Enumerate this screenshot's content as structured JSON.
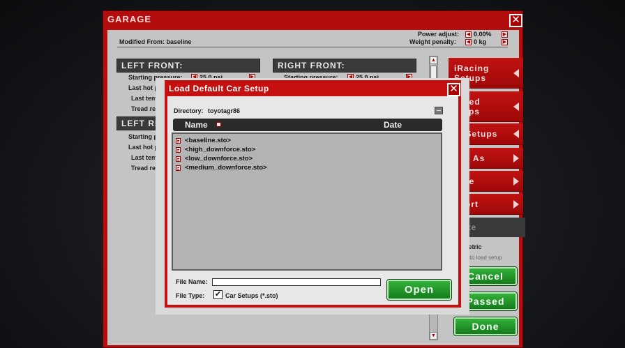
{
  "garage": {
    "title": "GARAGE",
    "modified_from": "Modified From: baseline",
    "power_adjust_label": "Power adjust:",
    "power_adjust_value": "0.00%",
    "weight_penalty_label": "Weight penalty:",
    "weight_penalty_value": "0 kg",
    "left_front": {
      "header": "LEFT FRONT:",
      "starting_pressure_label": "Starting pressure:",
      "starting_pressure_value": "25.0 psi",
      "last_hot_label": "Last hot pr",
      "last_temps_label": "Last temps",
      "tread_label": "Tread rem."
    },
    "right_front": {
      "header": "RIGHT FRONT:",
      "starting_pressure_label": "Starting pressure:",
      "starting_pressure_value": "25.0 psi"
    },
    "left_rear": {
      "header": "LEFT RE",
      "starting_label": "Starting pre",
      "last_hot_label": "Last hot pr",
      "last_temps_label": "Last temps",
      "tread_label": "Tread rem."
    },
    "side_menu": [
      {
        "label1": "iRacing",
        "label2": "Setups",
        "dir": "left"
      },
      {
        "label1": "hared",
        "label2": "etups",
        "dir": "left"
      },
      {
        "label1": "ly Setups",
        "label2": "",
        "dir": "left"
      },
      {
        "label1": "ave As",
        "label2": "",
        "dir": "right"
      },
      {
        "label1": "hare",
        "label2": "",
        "dir": "right"
      },
      {
        "label1": "xport",
        "label2": "",
        "dir": "right"
      }
    ],
    "delete_label": "elete",
    "metric_label": "Metric",
    "auto_load_label": "Auto load setup",
    "cancel_label": "Cancel",
    "passed_label": "Passed",
    "done_label": "Done"
  },
  "dialog": {
    "title": "Load Default Car Setup",
    "directory_label": "Directory:",
    "directory_value": "toyotagr86",
    "columns": {
      "name": "Name",
      "date": "Date"
    },
    "files": [
      "<baseline.sto>",
      "<high_downforce.sto>",
      "<low_downforce.sto>",
      "<medium_downforce.sto>"
    ],
    "file_name_label": "File Name:",
    "file_name_value": "",
    "file_type_label": "File Type:",
    "file_type_check": "✔",
    "file_type_value": "Car Setups (*.sto)",
    "open_label": "Open"
  },
  "icons": {
    "close": "close-icon",
    "arrow_left": "arrow-left-icon",
    "arrow_right": "arrow-right-icon",
    "sort": "sort-icon",
    "file": "file-icon",
    "folder_up": "folder-up-icon"
  },
  "colors": {
    "accent_red": "#c60f0f",
    "panel_gray": "#c4c4c4",
    "green_button": "#1e8f26"
  }
}
